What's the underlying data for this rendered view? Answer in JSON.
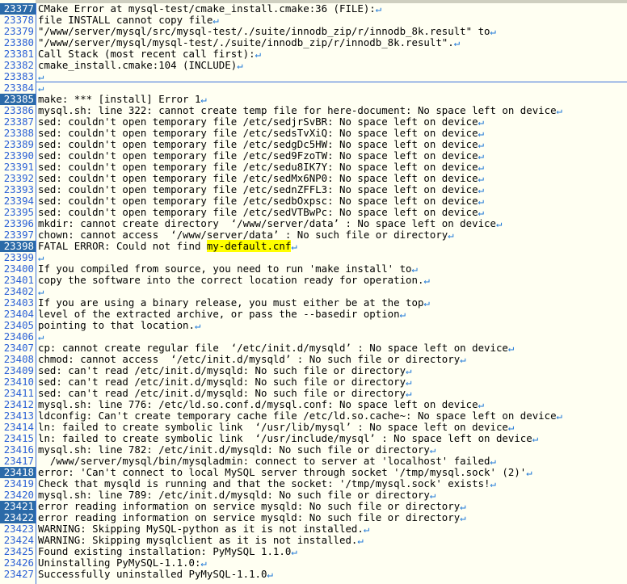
{
  "eol_mark": "↵",
  "lines": [
    {
      "n": "23377",
      "t": "CMake Error at mysql-test/cmake_install.cmake:36 (FILE):",
      "sel": true
    },
    {
      "n": "23378",
      "t": "file INSTALL cannot copy file"
    },
    {
      "n": "23379",
      "t": "\"/www/server/mysql/src/mysql-test/./suite/innodb_zip/r/innodb_8k.result\" to"
    },
    {
      "n": "23380",
      "t": "\"/www/server/mysql/mysql-test/./suite/innodb_zip/r/innodb_8k.result\"."
    },
    {
      "n": "23381",
      "t": "Call Stack (most recent call first):"
    },
    {
      "n": "23382",
      "t": "cmake_install.cmake:104 (INCLUDE)"
    },
    {
      "n": "23383",
      "t": ""
    },
    {
      "n": "23384",
      "t": ""
    },
    {
      "n": "23385",
      "t": "make: *** [install] Error 1",
      "sel": true
    },
    {
      "n": "23386",
      "t": "mysql.sh: line 322: cannot create temp file for here-document: No space left on device"
    },
    {
      "n": "23387",
      "t": "sed: couldn't open temporary file /etc/sedjrSvBR: No space left on device"
    },
    {
      "n": "23388",
      "t": "sed: couldn't open temporary file /etc/sedsTvXiQ: No space left on device"
    },
    {
      "n": "23389",
      "t": "sed: couldn't open temporary file /etc/sedgDc5HW: No space left on device"
    },
    {
      "n": "23390",
      "t": "sed: couldn't open temporary file /etc/sed9FzoTW: No space left on device"
    },
    {
      "n": "23391",
      "t": "sed: couldn't open temporary file /etc/sedu8IK7Y: No space left on device"
    },
    {
      "n": "23392",
      "t": "sed: couldn't open temporary file /etc/sedMx6NP0: No space left on device"
    },
    {
      "n": "23393",
      "t": "sed: couldn't open temporary file /etc/sednZFFL3: No space left on device"
    },
    {
      "n": "23394",
      "t": "sed: couldn't open temporary file /etc/sedbOxpsc: No space left on device"
    },
    {
      "n": "23395",
      "t": "sed: couldn't open temporary file /etc/sedVTBwPc: No space left on device"
    },
    {
      "n": "23396",
      "t": "mkdir: cannot create directory  ‘/www/server/data’ : No space left on device"
    },
    {
      "n": "23397",
      "t": "chown: cannot access  ‘/www/server/data’ : No such file or directory"
    },
    {
      "n": "23398",
      "t": "FATAL ERROR: Could not find ",
      "hl": "my-default.cnf",
      "sel": true
    },
    {
      "n": "23399",
      "t": ""
    },
    {
      "n": "23400",
      "t": "If you compiled from source, you need to run 'make install' to"
    },
    {
      "n": "23401",
      "t": "copy the software into the correct location ready for operation."
    },
    {
      "n": "23402",
      "t": ""
    },
    {
      "n": "23403",
      "t": "If you are using a binary release, you must either be at the top"
    },
    {
      "n": "23404",
      "t": "level of the extracted archive, or pass the --basedir option"
    },
    {
      "n": "23405",
      "t": "pointing to that location."
    },
    {
      "n": "23406",
      "t": ""
    },
    {
      "n": "23407",
      "t": "cp: cannot create regular file  ‘/etc/init.d/mysqld’ : No space left on device"
    },
    {
      "n": "23408",
      "t": "chmod: cannot access  ‘/etc/init.d/mysqld’ : No such file or directory"
    },
    {
      "n": "23409",
      "t": "sed: can't read /etc/init.d/mysqld: No such file or directory"
    },
    {
      "n": "23410",
      "t": "sed: can't read /etc/init.d/mysqld: No such file or directory"
    },
    {
      "n": "23411",
      "t": "sed: can't read /etc/init.d/mysqld: No such file or directory"
    },
    {
      "n": "23412",
      "t": "mysql.sh: line 776: /etc/ld.so.conf.d/mysql.conf: No space left on device"
    },
    {
      "n": "23413",
      "t": "ldconfig: Can't create temporary cache file /etc/ld.so.cache~: No space left on device"
    },
    {
      "n": "23414",
      "t": "ln: failed to create symbolic link  ‘/usr/lib/mysql’ : No space left on device"
    },
    {
      "n": "23415",
      "t": "ln: failed to create symbolic link  ‘/usr/include/mysql’ : No space left on device"
    },
    {
      "n": "23416",
      "t": "mysql.sh: line 782: /etc/init.d/mysqld: No such file or directory"
    },
    {
      "n": "23417",
      "t": "  /www/server/mysql/bin/mysqladmin: connect to server at 'localhost' failed"
    },
    {
      "n": "23418",
      "t": "error: 'Can't connect to local MySQL server through socket '/tmp/mysql.sock' (2)'",
      "sel": true
    },
    {
      "n": "23419",
      "t": "Check that mysqld is running and that the socket: '/tmp/mysql.sock' exists!"
    },
    {
      "n": "23420",
      "t": "mysql.sh: line 789: /etc/init.d/mysqld: No such file or directory"
    },
    {
      "n": "23421",
      "t": "error reading information on service mysqld: No such file or directory",
      "sel": true
    },
    {
      "n": "23422",
      "t": "error reading information on service mysqld: No such file or directory",
      "sel": true
    },
    {
      "n": "23423",
      "t": "WARNING: Skipping MySQL-python as it is not installed."
    },
    {
      "n": "23424",
      "t": "WARNING: Skipping mysqlclient as it is not installed."
    },
    {
      "n": "23425",
      "t": "Found existing installation: PyMySQL 1.1.0"
    },
    {
      "n": "23426",
      "t": "Uninstalling PyMySQL-1.1.0:"
    },
    {
      "n": "23427",
      "t": "Successfully uninstalled PyMySQL-1.1.0"
    }
  ]
}
